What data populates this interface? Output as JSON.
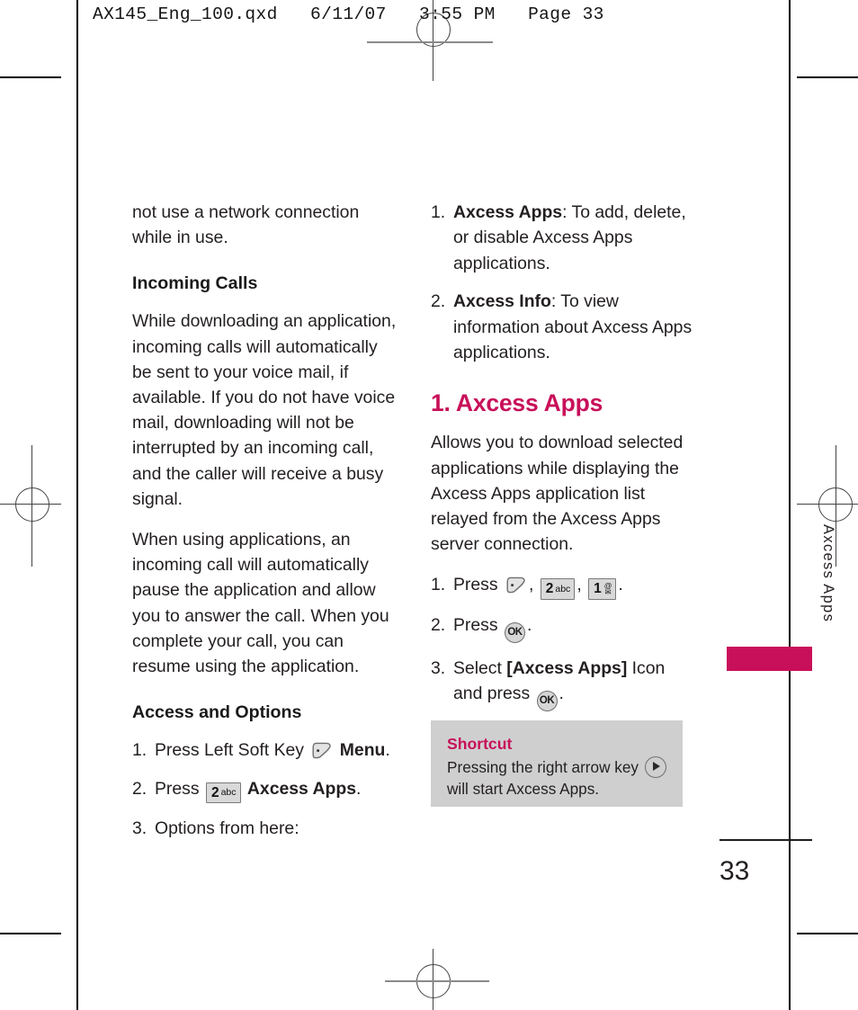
{
  "printer_slug": "AX145_Eng_100.qxd   6/11/07   3:55 PM   Page 33",
  "left_column": {
    "continued_paragraph": "not use a network connection while in use.",
    "heading_incoming_calls": "Incoming Calls",
    "paragraph_1": "While downloading an application, incoming calls will automatically be sent to your voice mail, if available. If you do not have voice mail, downloading will not be interrupted by an incoming call, and the caller will receive a busy signal.",
    "paragraph_2": "When using applications, an incoming call will automatically pause the application and allow you to answer the call. When you complete your call, you can resume using the application.",
    "heading_access_options": "Access and Options",
    "steps": [
      {
        "number": "1.",
        "text_before": "Press Left Soft Key",
        "icon": "left-soft-key-icon",
        "text_bold": "Menu",
        "text_after": "."
      },
      {
        "number": "2.",
        "text_before": "Press",
        "key_digit": "2",
        "key_sub": "abc",
        "text_bold": "Axcess Apps",
        "text_after": "."
      },
      {
        "number": "3.",
        "text_before": "Options from here:",
        "text_after": ""
      }
    ]
  },
  "right_column": {
    "options_list": [
      {
        "number": "1.",
        "label": "Axcess Apps",
        "description": ": To add, delete, or disable Axcess Apps applications."
      },
      {
        "number": "2.",
        "label": "Axcess Info",
        "description": ": To view information about Axcess Apps applications."
      }
    ],
    "section_heading": "1. Axcess Apps",
    "section_paragraph": "Allows you to download selected applications while displaying the Axcess Apps application list relayed from the Axcess Apps server connection.",
    "steps": [
      {
        "number": "1.",
        "text_before": "Press",
        "keys": [
          {
            "type": "soft-key",
            "name": "left-soft-key-icon"
          },
          {
            "type": "keypad",
            "digit": "2",
            "sub": "abc"
          },
          {
            "type": "keypad",
            "digit": "1",
            "sub_top": "@",
            "sub_bottom": "envelope"
          }
        ],
        "text_after": "."
      },
      {
        "number": "2.",
        "text_before": "Press",
        "key": "OK",
        "text_after": "."
      },
      {
        "number": "3.",
        "text_before": "Select",
        "text_bold": "[Axcess Apps]",
        "text_middle": "Icon and press",
        "key": "OK",
        "text_after": "."
      }
    ]
  },
  "shortcut_box": {
    "title": "Shortcut",
    "line_1": "Pressing the right arrow key",
    "icon": "right-arrow-key-icon",
    "line_2": "will start Axcess Apps."
  },
  "side_tab": {
    "label": "Axcess Apps"
  },
  "folio": {
    "page_number": "33"
  },
  "colors": {
    "accent_crimson": "#c8105a",
    "body_text": "#231f20",
    "callout_background": "#cfcfcf",
    "key_background": "#d9d9d9"
  },
  "key_labels": {
    "ok": "OK"
  }
}
